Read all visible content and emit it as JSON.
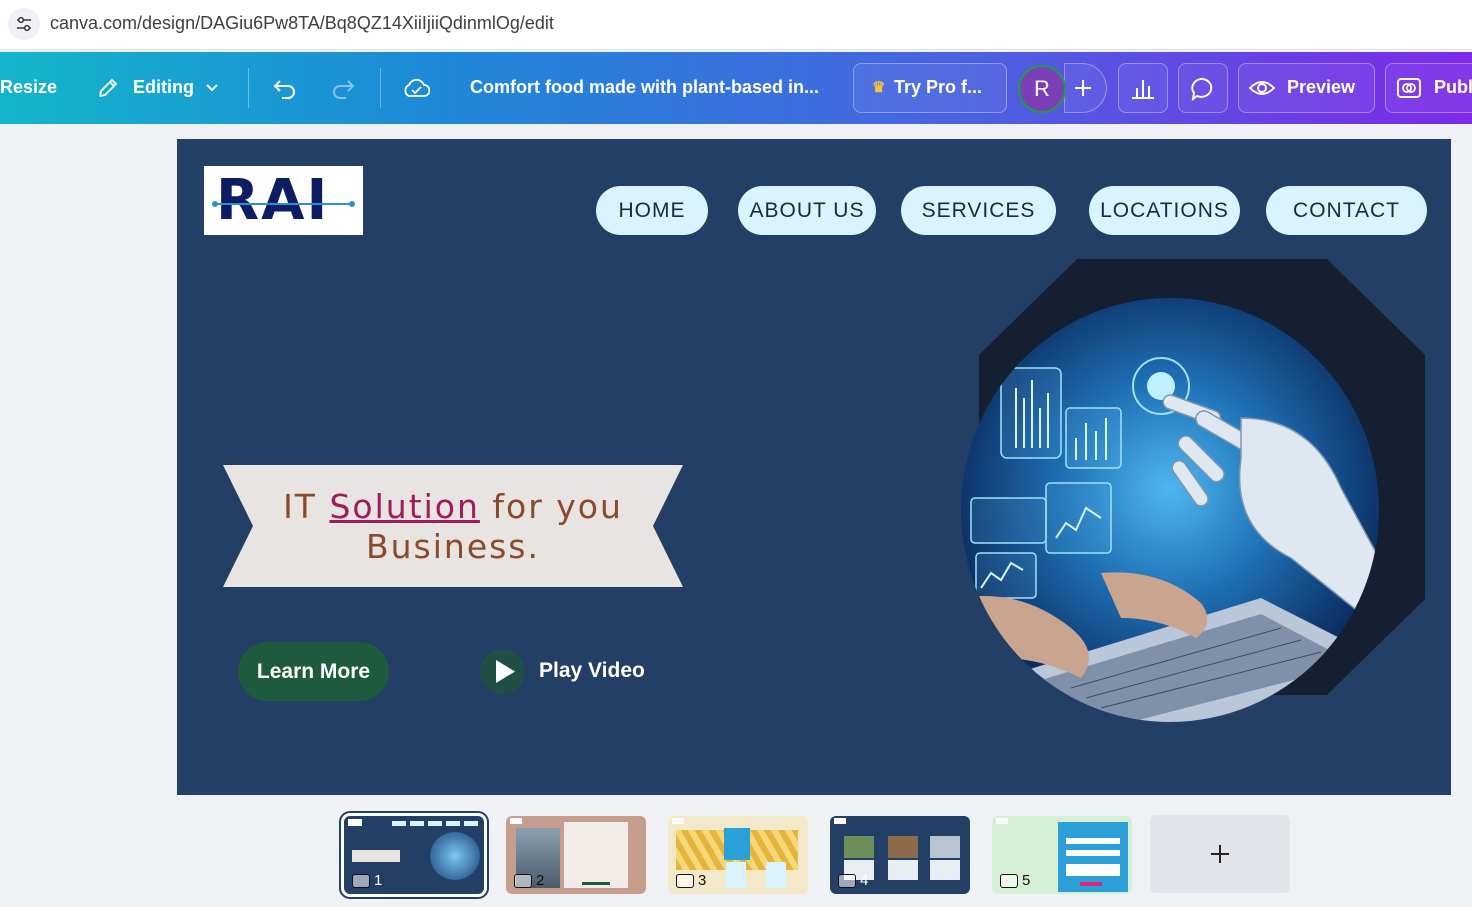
{
  "browser": {
    "url": "canva.com/design/DAGiu6Pw8TA/Bq8QZ14XiiIjiiQdinmlOg/edit"
  },
  "toolbar": {
    "resize_label": "Resize",
    "editing_label": "Editing",
    "design_title": "Comfort food made with plant-based in...",
    "try_pro_label": "Try Pro f...",
    "avatar_initial": "R",
    "preview_label": "Preview",
    "publish_label": "Publ",
    "gradient": [
      "#13b5cb",
      "#1e88d8",
      "#4a62e0",
      "#7d2ae8"
    ]
  },
  "slide": {
    "background": "#233f65",
    "logo_text": "RAI",
    "nav": [
      "HOME",
      "ABOUT US",
      "SERVICES",
      "LOCATIONS",
      "CONTACT"
    ],
    "banner": {
      "word1": "IT",
      "word2": "Solution",
      "word3": "for you",
      "word4": "Business."
    },
    "learn_more": "Learn More",
    "play_video": "Play Video",
    "hero_image": "robot-hand-laptop-photo"
  },
  "pages": {
    "thumbnails": [
      {
        "number": "1",
        "theme": "#233f65",
        "selected": true
      },
      {
        "number": "2",
        "theme": "#c59e8e",
        "selected": false
      },
      {
        "number": "3",
        "theme": "#f1e9c9",
        "selected": false
      },
      {
        "number": "4",
        "theme": "#233f65",
        "selected": false
      },
      {
        "number": "5",
        "theme": "#d6f0d6",
        "selected": false
      }
    ],
    "add_page_icon": "plus-icon"
  }
}
